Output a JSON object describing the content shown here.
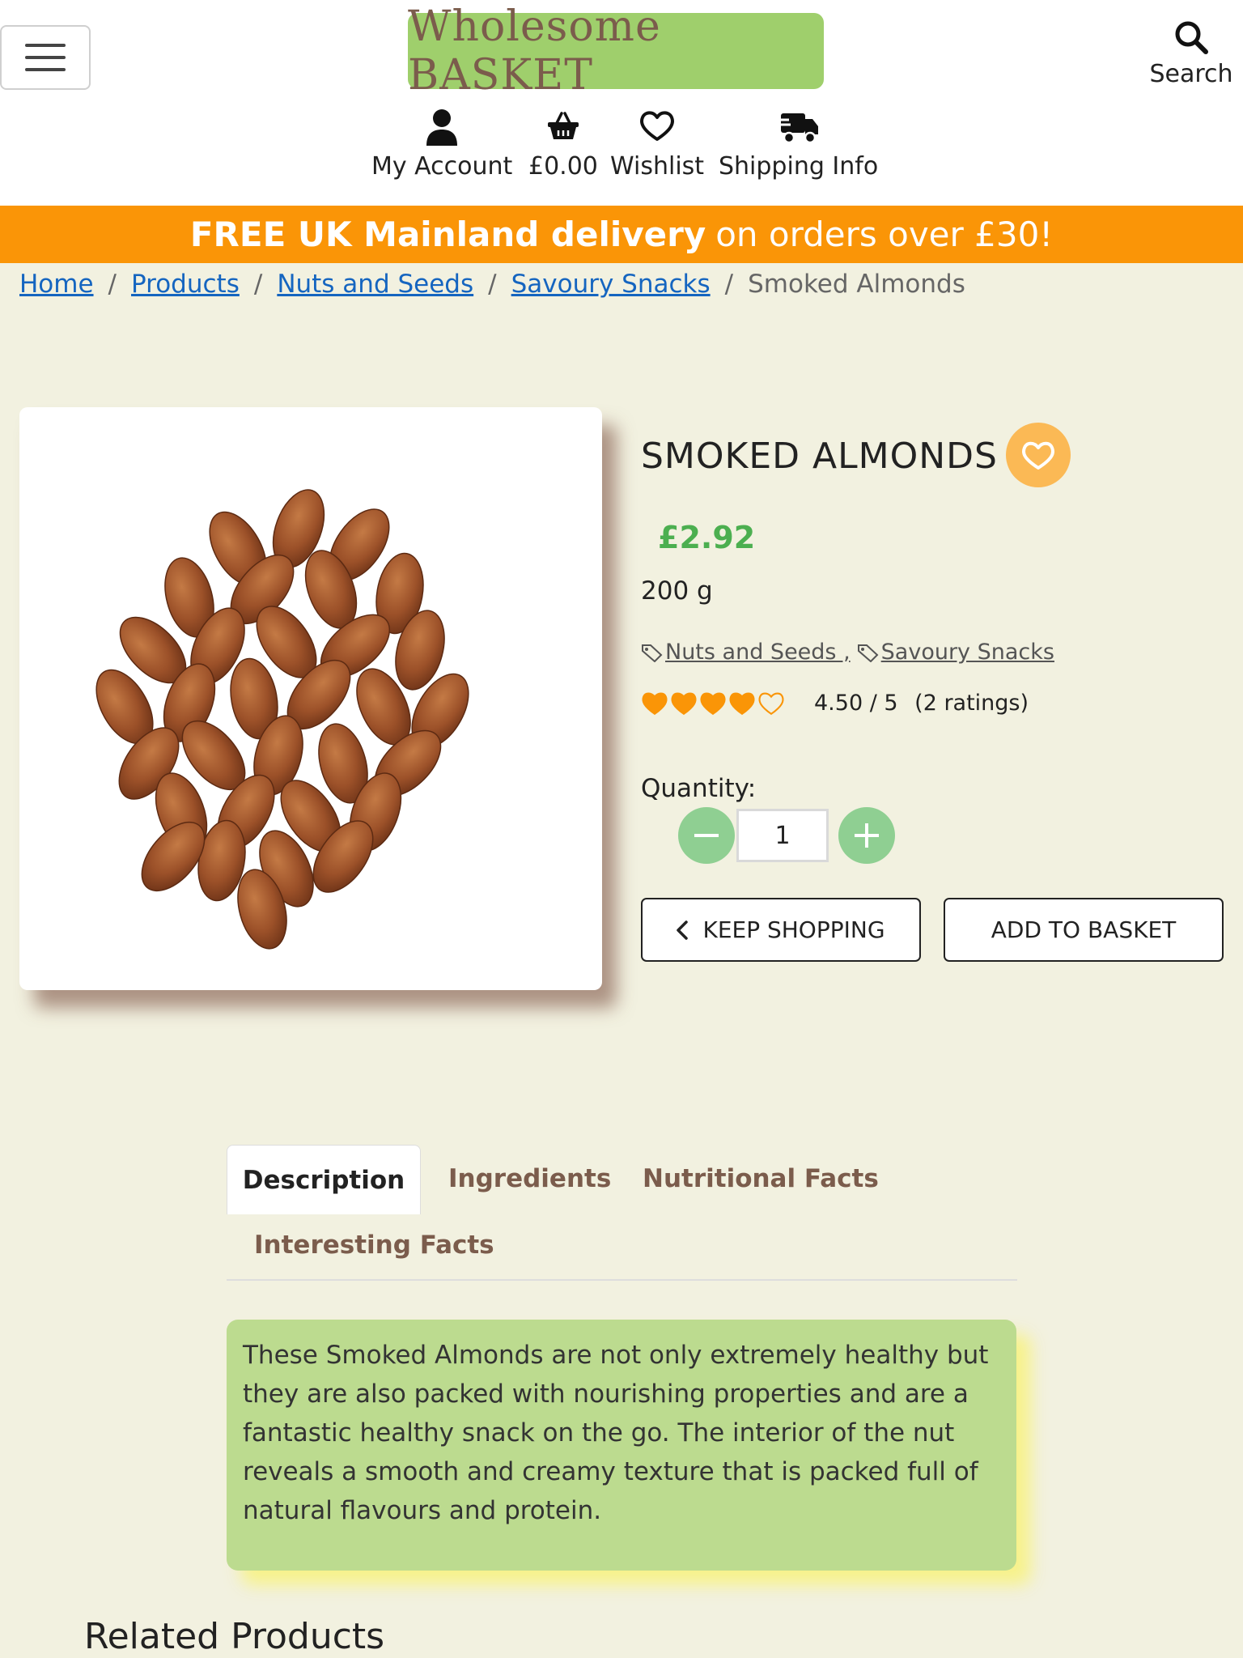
{
  "header": {
    "logo_text": "Wholesome BASKET",
    "search_label": "Search",
    "nav": {
      "account_label": "My Account",
      "basket_label": "£0.00",
      "wishlist_label": "Wishlist",
      "shipping_label": "Shipping Info"
    }
  },
  "promo": {
    "bold_text": "FREE UK Mainland delivery",
    "rest_text": "on orders over £30!"
  },
  "breadcrumb": {
    "items": [
      "Home",
      "Products",
      "Nuts and Seeds",
      "Savoury Snacks"
    ],
    "current": "Smoked Almonds",
    "separator": "/"
  },
  "product": {
    "title": "SMOKED ALMONDS",
    "price": "£2.92",
    "weight": "200 g",
    "tags": [
      "Nuts and Seeds ,",
      "Savoury Snacks"
    ],
    "rating": {
      "value": 4.5,
      "display": "4.50 / 5",
      "count_text": "(2 ratings)",
      "filled_stars": 4,
      "total_stars": 5
    },
    "quantity_label": "Quantity:",
    "quantity_value": "1",
    "keep_shopping_label": "KEEP SHOPPING",
    "add_to_basket_label": "ADD TO BASKET"
  },
  "tabs": {
    "items": [
      "Description",
      "Ingredients",
      "Nutritional Facts",
      "Interesting Facts"
    ],
    "active": "Description"
  },
  "description_text": "These Smoked Almonds are not only extremely healthy but they are also packed with nourishing properties and are a fantastic healthy snack on the go. The interior of the nut reveals a smooth and creamy texture that is packed full of natural flavours and protein.",
  "related_heading": "Related Products",
  "colors": {
    "logo_bg": "#9fcf6c",
    "promo_bg": "#fa9507",
    "price": "#4caf50",
    "star": "#fa9507",
    "wishlist_circle": "#fbb955",
    "description_bg": "#bcdb8f",
    "qty_button": "#8fcf92"
  }
}
